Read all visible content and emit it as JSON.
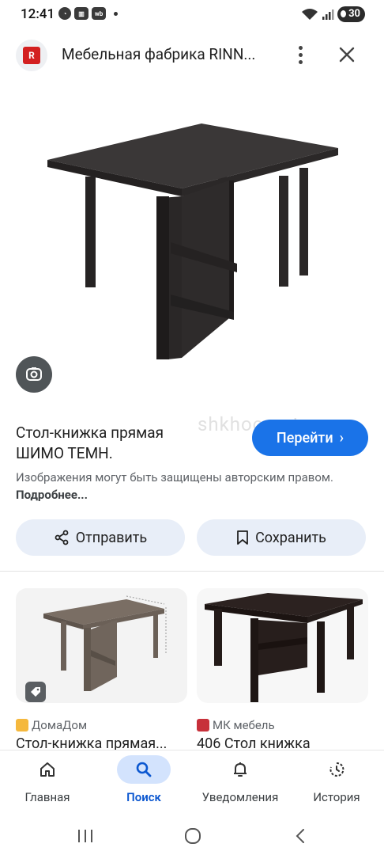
{
  "status_bar": {
    "time": "12:41",
    "battery": "30",
    "left_icons": [
      "whatsapp-icon",
      "app-icon",
      "wb-icon"
    ],
    "right_icons": [
      "wifi-icon",
      "signal-icon",
      "battery-icon"
    ]
  },
  "top_bar": {
    "logo_letter": "R",
    "title": "Мебельная фабрика RINN...",
    "more_icon": "more-vert-icon",
    "close_icon": "close-icon"
  },
  "hero": {
    "lens_icon": "google-lens-icon"
  },
  "watermark": "shkhoo-auto.ru",
  "product": {
    "title_line1": "Стол-книжка прямая",
    "title_line2": "ШИМО ТЕМН.",
    "go_button": "Перейти",
    "copyright_text": "Изображения могут быть защищены авторским правом.",
    "copyright_more": "Подробнее..."
  },
  "actions": {
    "share_label": "Отправить",
    "save_label": "Сохранить"
  },
  "related": [
    {
      "source": "ДомаДом",
      "title": "Стол-книжка прямая...",
      "badge_icon": "tag-icon"
    },
    {
      "source": "МК мебель",
      "title": "406 Стол книжка"
    }
  ],
  "bottom_nav": [
    {
      "label": "Главная",
      "icon": "home-icon",
      "active": false
    },
    {
      "label": "Поиск",
      "icon": "search-icon",
      "active": true
    },
    {
      "label": "Уведомления",
      "icon": "bell-icon",
      "active": false
    },
    {
      "label": "История",
      "icon": "history-icon",
      "active": false
    }
  ],
  "colors": {
    "accent": "#1a73e8",
    "chip_bg": "#e8eef8",
    "active_nav": "#d3e3fd",
    "logo_red": "#d32020"
  }
}
